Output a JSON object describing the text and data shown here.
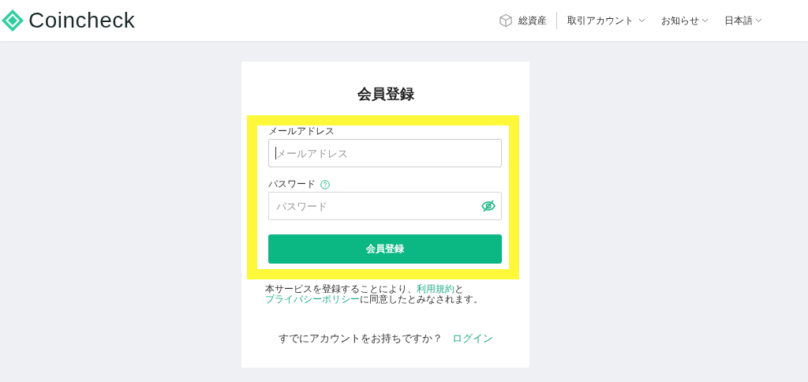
{
  "header": {
    "logo": "Coincheck",
    "nav": [
      {
        "label": "総資産",
        "kind": "assets"
      },
      {
        "label": "取引アカウント",
        "kind": "menu"
      },
      {
        "label": "お知らせ",
        "kind": "menu"
      },
      {
        "label": "日本語",
        "kind": "menu"
      }
    ]
  },
  "form": {
    "title": "会員登録",
    "highlighted": true,
    "fields": [
      {
        "label": "メールアドレス",
        "placeholder": "メールアドレス",
        "focused": true,
        "help": false,
        "reveal_toggle": false
      },
      {
        "label": "パスワード",
        "placeholder": "パスワード",
        "focused": false,
        "help": true,
        "reveal_toggle": true
      }
    ],
    "submit": "会員登録",
    "terms": [
      {
        "kind": "text",
        "text": "本サービスを登録することにより、"
      },
      {
        "kind": "link",
        "text": "利用規約"
      },
      {
        "kind": "text",
        "text": "と"
      },
      {
        "kind": "link",
        "text": "プライバシーポリシー"
      },
      {
        "kind": "text",
        "text": "に同意したとみなされます。"
      }
    ],
    "login_prompt": "すでにアカウントをお持ちですか？",
    "login_link": "ログイン"
  }
}
